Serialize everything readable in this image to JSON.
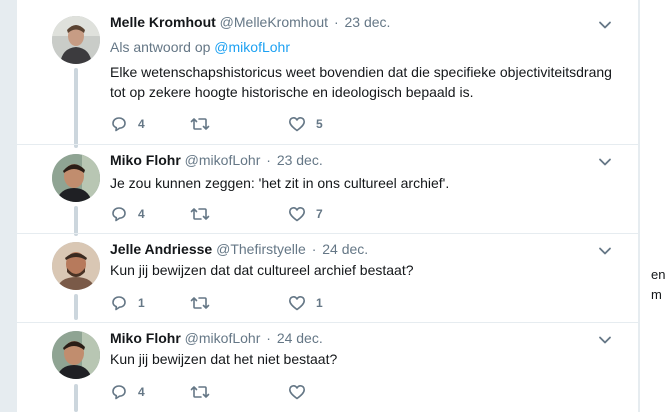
{
  "tweets": [
    {
      "fullname": "Melle Kromhout",
      "screen_name": "@MelleKromhout",
      "separator": "·",
      "time": "23 dec.",
      "reply_prefix": "Als antwoord op",
      "reply_to": "@mikofLohr",
      "text_line1": "Elke wetenschapshistoricus weet bovendien dat die specifieke objectiviteitsdrang",
      "text_line2": "tot op zekere hoogte historische en ideologisch bepaald is.",
      "replies": "4",
      "retweets": "",
      "likes": "5"
    },
    {
      "fullname": "Miko Flohr",
      "screen_name": "@mikofLohr",
      "separator": "·",
      "time": "23 dec.",
      "text_line1": "Je zou kunnen zeggen: 'het zit in ons cultureel archief'.",
      "replies": "4",
      "retweets": "",
      "likes": "7"
    },
    {
      "fullname": "Jelle Andriesse",
      "screen_name": "@Thefirstyelle",
      "separator": "·",
      "time": "24 dec.",
      "text_line1": "Kun jij bewijzen dat dat cultureel archief bestaat?",
      "replies": "1",
      "retweets": "",
      "likes": "1"
    },
    {
      "fullname": "Miko Flohr",
      "screen_name": "@mikofLohr",
      "separator": "·",
      "time": "24 dec.",
      "text_line1": "Kun jij bewijzen dat het niet bestaat?",
      "replies": "4",
      "retweets": "",
      "likes": ""
    }
  ],
  "right_panel": {
    "fragment1": "en",
    "fragment2": "m"
  },
  "colors": {
    "accent": "#1da1f2",
    "muted": "#657786",
    "thread_line": "#ccd6dd"
  },
  "icons": [
    "reply-icon",
    "retweet-icon",
    "like-icon",
    "chevron-down-icon"
  ]
}
